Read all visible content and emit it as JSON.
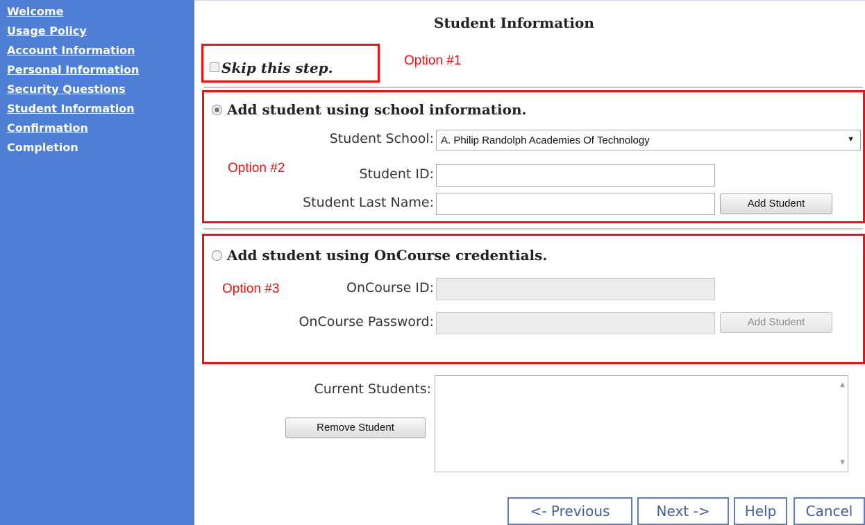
{
  "sidebar": {
    "items": [
      {
        "label": "Welcome"
      },
      {
        "label": "Usage Policy"
      },
      {
        "label": "Account Information"
      },
      {
        "label": "Personal Information"
      },
      {
        "label": "Security Questions"
      },
      {
        "label": "Student Information"
      },
      {
        "label": "Confirmation"
      },
      {
        "label": "Completion"
      }
    ]
  },
  "page": {
    "title": "Student Information"
  },
  "option1": {
    "skip_label": "Skip this step.",
    "annotation": "Option #1"
  },
  "option2": {
    "title": "Add student using school information.",
    "annotation": "Option #2",
    "school_label": "Student School:",
    "school_value": "A. Philip Randolph Academies Of Technology",
    "id_label": "Student ID:",
    "id_value": "",
    "lastname_label": "Student Last Name:",
    "lastname_value": "",
    "add_button": "Add Student"
  },
  "option3": {
    "title": "Add student using OnCourse credentials.",
    "annotation": "Option #3",
    "id_label": "OnCourse ID:",
    "id_value": "",
    "password_label": "OnCourse Password:",
    "password_value": "",
    "add_button": "Add Student"
  },
  "current": {
    "label": "Current Students:",
    "remove_button": "Remove Student"
  },
  "footer": {
    "previous": "<- Previous",
    "next": "Next ->",
    "help": "Help",
    "cancel": "Cancel"
  },
  "colors": {
    "sidebar": "#4f7fd4",
    "annotation": "#ee1111",
    "nav_border": "#5b7fc0"
  },
  "icons": {
    "dropdown": "chevron-down-icon",
    "scroll_up": "scroll-up-icon",
    "scroll_down": "scroll-down-icon"
  }
}
